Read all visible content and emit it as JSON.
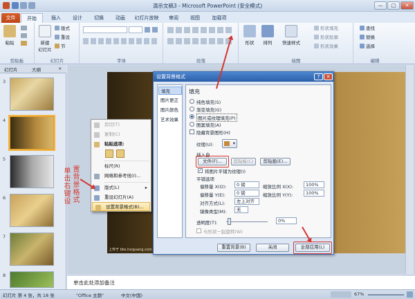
{
  "window": {
    "title": "演示文稿3 - Microsoft PowerPoint (安全模式)",
    "min": "—",
    "max": "□",
    "close": "✕"
  },
  "ribbon_tabs": [
    "文件",
    "开始",
    "插入",
    "设计",
    "切换",
    "动画",
    "幻灯片放映",
    "审阅",
    "视图",
    "加载项"
  ],
  "ribbon": {
    "groups": [
      "剪贴板",
      "幻灯片",
      "字体",
      "段落",
      "绘图",
      "编辑"
    ],
    "paste": "粘贴",
    "new_slide": "新建\n幻灯片",
    "layout": "版式",
    "reset": "重设",
    "section": "节",
    "shapes": "形状",
    "arrange": "排列",
    "quick_styles": "快速样式",
    "shape_fill": "形状填充",
    "shape_outline": "形状轮廓",
    "shape_effects": "形状效果",
    "find": "查找",
    "replace": "替换",
    "select": "选择"
  },
  "left_panel": {
    "tabs": [
      "幻灯片",
      "大纲"
    ],
    "close": "×",
    "slide_numbers": [
      "3",
      "4",
      "5",
      "6",
      "7",
      "8"
    ]
  },
  "context_menu": {
    "items": [
      {
        "label": "剪切(T)",
        "disabled": true
      },
      {
        "label": "复制(C)",
        "disabled": true
      },
      {
        "label": "粘贴选项:",
        "disabled": false
      },
      {
        "label": "标尺(R)",
        "disabled": false
      },
      {
        "label": "网格和参考线(I)...",
        "disabled": false
      },
      {
        "label": "版式(L)",
        "disabled": false
      },
      {
        "label": "重设幻灯片(A)",
        "disabled": false
      },
      {
        "label": "设置背景格式(B)...",
        "disabled": false
      }
    ]
  },
  "annotation": {
    "col1": "单击右键设",
    "col2": "置背景格式"
  },
  "dialog": {
    "title": "设置背景格式",
    "help": "?",
    "close": "✕",
    "nav": [
      "填充",
      "图片更正",
      "图片颜色",
      "艺术效果"
    ],
    "section_title": "填充",
    "fill_options": [
      {
        "label": "纯色填充(S)",
        "selected": false
      },
      {
        "label": "渐变填充(G)",
        "selected": false
      },
      {
        "label": "图片或纹理填充(P)",
        "selected": true
      },
      {
        "label": "图案填充(A)",
        "selected": false
      }
    ],
    "hide_bg_graphics": "隐藏背景图形(H)",
    "texture_label": "纹理(U):",
    "insert_from": "插入自",
    "file_button": "文件(F)...",
    "clipboard_button": "剪贴板(C)",
    "clipart_button": "剪贴画(E)...",
    "tile_checkbox": "将图片平铺为纹理(I)",
    "tile_options": "平铺选项",
    "offset_x_label": "偏移量 X(O):",
    "offset_x_value": "0 磅",
    "offset_y_label": "偏移量 Y(E):",
    "offset_y_value": "0 磅",
    "scale_x_label": "缩放比例 X(X):",
    "scale_x_value": "100%",
    "scale_y_label": "缩放比例 Y(Y):",
    "scale_y_value": "100%",
    "align_label": "对齐方式(L):",
    "align_value": "左上对齐",
    "mirror_label": "镜像类型(M):",
    "mirror_value": "无",
    "transparency_label": "透明度(T):",
    "transparency_value": "0%",
    "rotate_with_shape": "与形状一起旋转(W)",
    "reset_button": "重置背景(B)",
    "close_button": "关闭",
    "apply_all_button": "全部应用(L)"
  },
  "notes_placeholder": "单击此处添加备注",
  "status": {
    "slide_info": "幻灯片 第 4 张，共 18 张",
    "theme": "\"Office 主题\"",
    "language": "中文(中国)",
    "zoom": "67%"
  },
  "watermark": "上传于 bbs.hxiguang.com"
}
